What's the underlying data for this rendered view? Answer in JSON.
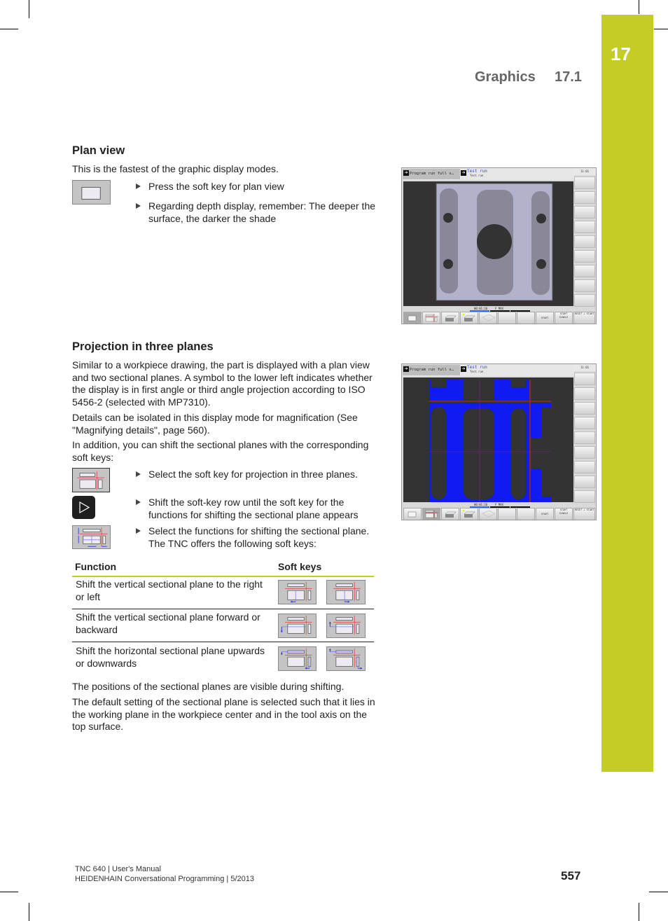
{
  "chapter": {
    "number": "17",
    "section_title": "Graphics",
    "section_number": "17.1",
    "accent_color": "#c3cd24"
  },
  "plan_view": {
    "heading": "Plan view",
    "intro": "This is the fastest of the graphic display modes.",
    "steps": [
      "Press the soft key for plan view",
      "Regarding depth display, remember: The deeper the surface, the darker the shade"
    ],
    "softkey_icon": "plan-view-softkey-icon"
  },
  "projection": {
    "heading": "Projection in three planes",
    "paragraphs": [
      "Similar to a workpiece drawing, the part is displayed with a plan view and two sectional planes. A symbol to the lower left indicates whether the display is in first angle or third angle projection according to ISO 5456-2 (selected with MP7310).",
      "Details can be isolated in this display mode for magnification (See \"Magnifying details\", page 560).",
      "In addition, you can shift the sectional planes with the corresponding soft keys:"
    ],
    "steps": [
      "Select the soft key for projection in three planes.",
      "Shift the soft-key row until the soft key for the functions for shifting the sectional plane appears",
      "Select the functions for shifting the sectional plane. The TNC offers the following soft keys:"
    ],
    "table": {
      "headers": [
        "Function",
        "Soft keys"
      ],
      "rows": [
        {
          "function": "Shift the vertical sectional plane to the right or left",
          "softkeys": [
            "shift-left-icon",
            "shift-right-icon"
          ]
        },
        {
          "function": "Shift the vertical sectional plane forward or backward",
          "softkeys": [
            "shift-forward-icon",
            "shift-backward-icon"
          ]
        },
        {
          "function": "Shift the horizontal sectional plane upwards or downwards",
          "softkeys": [
            "shift-down-icon",
            "shift-up-icon"
          ]
        }
      ]
    },
    "closing": [
      "The positions of the sectional planes are visible during shifting.",
      "The default setting of the sectional plane is selected such that it lies in the working plane in the workpiece center and in the tool axis on the top surface."
    ]
  },
  "screenshots": {
    "mode_active": "Program run full s…",
    "mode_secondary": "Test run",
    "mode_secondary_sub": "Test run",
    "clock": "11:01",
    "status_time": "00:01:16",
    "status_feed": "F MAX",
    "softkeys_bottom": [
      "",
      "",
      "",
      "",
      "",
      "",
      "",
      "START",
      "START SINGLE",
      "RESET + START"
    ]
  },
  "footer": {
    "line1": "TNC 640 | User's Manual",
    "line2": "HEIDENHAIN Conversational Programming | 5/2013",
    "page": "557"
  }
}
